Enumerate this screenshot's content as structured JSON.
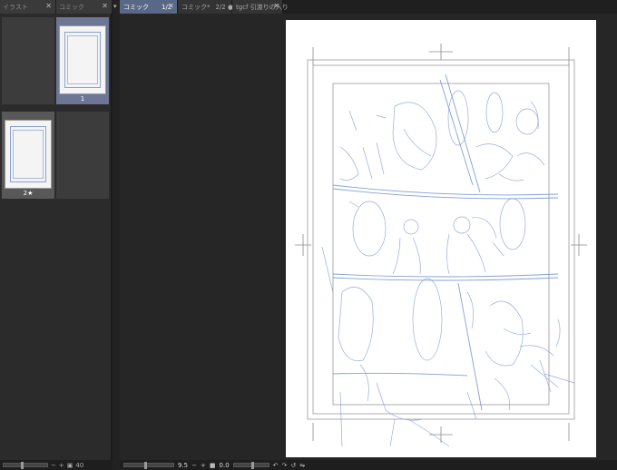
{
  "left_panel": {
    "tabs": [
      {
        "label": "イラスト"
      },
      {
        "label": "コミック"
      }
    ],
    "pages": [
      {
        "label": "1"
      },
      {
        "label": "2★"
      }
    ],
    "zoom_value": "40"
  },
  "doc_tabs": [
    {
      "label": "コミック",
      "page": "1/2"
    },
    {
      "label": "コミック*",
      "page": "2/2 ●"
    },
    {
      "label": "tgcf 引渡りの入り"
    }
  ],
  "status": {
    "zoom": "9.5",
    "angle": "0.0"
  },
  "icons": {
    "close": "close-icon",
    "collapse": "chevron-down-icon",
    "zoom_in": "plus-icon",
    "zoom_out": "minus-icon",
    "rotate_left": "rotate-left-icon",
    "rotate_right": "rotate-right-icon",
    "reset": "reset-icon",
    "flip": "flip-icon"
  }
}
